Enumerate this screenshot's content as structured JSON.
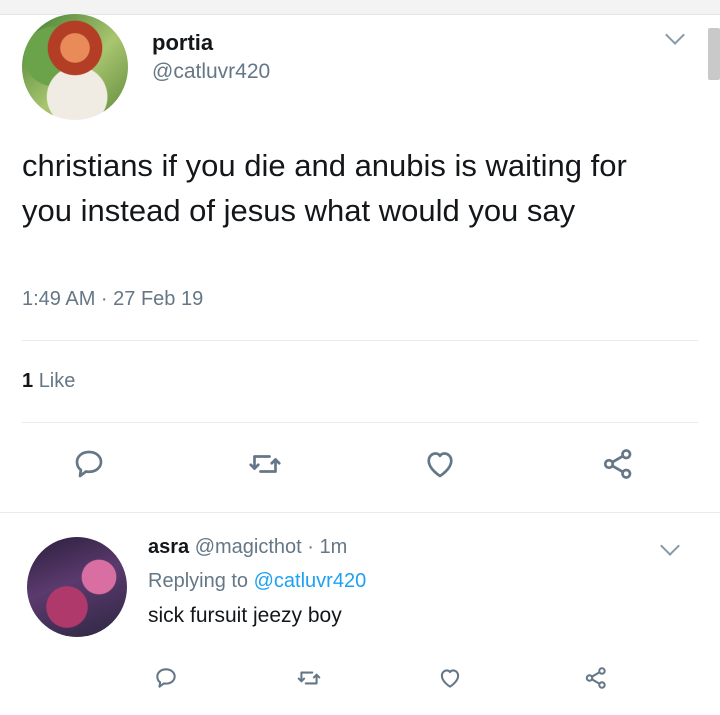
{
  "tweet": {
    "display_name": "portia",
    "handle": "@catluvr420",
    "text": "christians if you die and anubis is waiting for you instead of jesus what would you say",
    "timestamp": "1:49 AM · 27 Feb 19",
    "like_count": "1",
    "like_label": "Like"
  },
  "reply": {
    "display_name": "asra",
    "handle": "@magicthot",
    "separator": "·",
    "time": "1m",
    "replying_prefix": "Replying to",
    "replying_to": "@catluvr420",
    "text": "sick fursuit jeezy boy"
  },
  "icons": {
    "reply": "reply-icon",
    "retweet": "retweet-icon",
    "like": "heart-icon",
    "share": "share-icon",
    "more": "chevron-down-icon"
  },
  "colors": {
    "icon": "#657786",
    "link": "#1da1f2",
    "text": "#14171a",
    "muted": "#657786"
  }
}
